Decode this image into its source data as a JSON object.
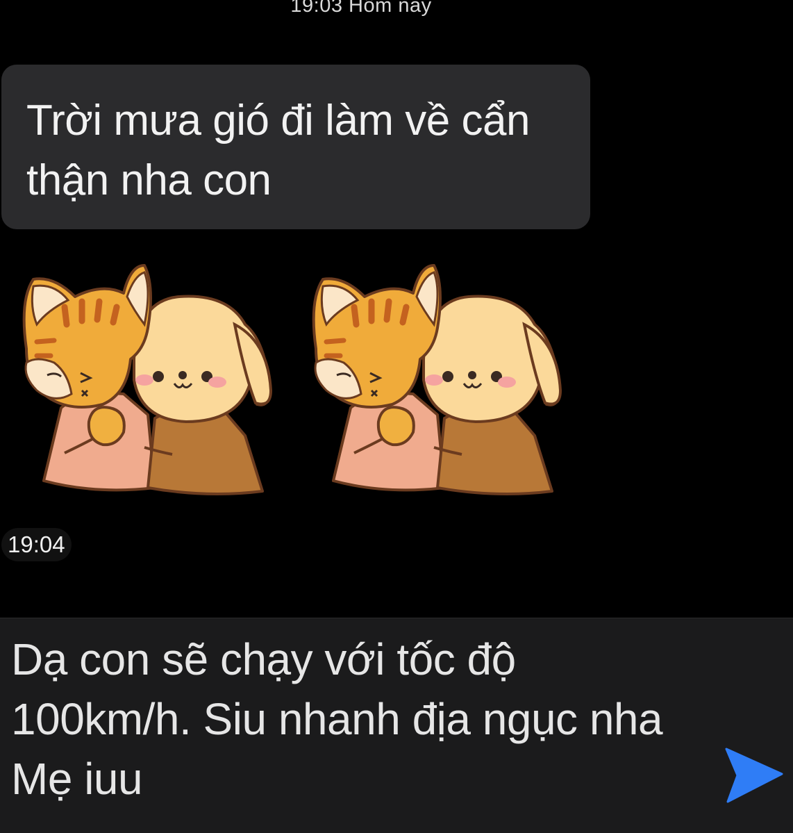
{
  "header": {
    "timestamp": "19:03 Hôm nay"
  },
  "messages": [
    {
      "type": "text",
      "direction": "incoming",
      "text": "Trời mưa gió đi làm về cẩn thận nha con"
    },
    {
      "type": "sticker",
      "direction": "incoming",
      "stickers": [
        "cat-hugging-dog-sticker",
        "cat-hugging-dog-sticker"
      ]
    }
  ],
  "time_label": "19:04",
  "composer": {
    "value": "Dạ con sẽ chạy với tốc độ 100km/h. Siu nhanh địa ngục nha Mẹ iuu",
    "send_icon": "send-arrow-icon"
  },
  "colors": {
    "background": "#000000",
    "bubble": "#2b2b2d",
    "composer": "#1b1b1c",
    "send_accent": "#2f7df6"
  }
}
